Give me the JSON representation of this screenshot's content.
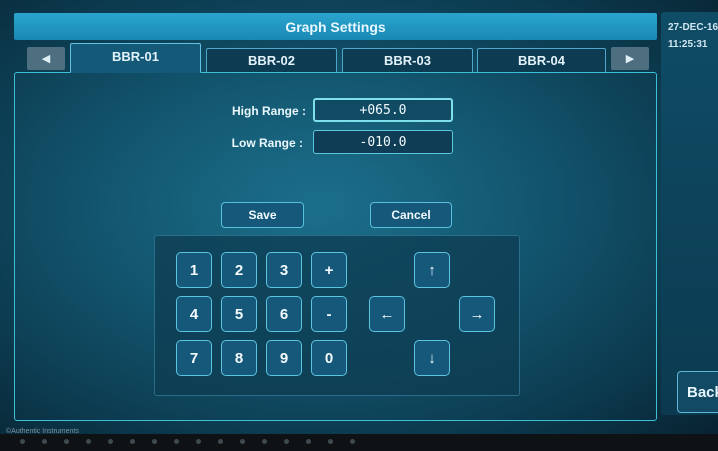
{
  "window": {
    "title": "Graph Settings"
  },
  "status": {
    "date": "27-DEC-16",
    "time": "11:25:31"
  },
  "tabs": {
    "prev_icon": "left-triangle-icon",
    "next_icon": "right-triangle-icon",
    "items": [
      {
        "label": "BBR-01",
        "active": true
      },
      {
        "label": "BBR-02",
        "active": false
      },
      {
        "label": "BBR-03",
        "active": false
      },
      {
        "label": "BBR-04",
        "active": false
      }
    ]
  },
  "form": {
    "high_range": {
      "label": "High Range :",
      "value": "+065.0"
    },
    "low_range": {
      "label": "Low Range :",
      "value": "-010.0"
    }
  },
  "actions": {
    "save_label": "Save",
    "cancel_label": "Cancel",
    "back_label": "Back"
  },
  "keypad": {
    "keys": [
      "1",
      "2",
      "3",
      "+",
      "4",
      "5",
      "6",
      "-",
      "7",
      "8",
      "9",
      "0"
    ],
    "arrows": {
      "up": "↑",
      "left": "←",
      "right": "→",
      "down": "↓"
    }
  },
  "footer": {
    "copyright": "©Authentic Instruments"
  },
  "colors": {
    "accent": "#2aa5cf",
    "border": "#5cc7dc",
    "background": "#0f4b63"
  }
}
